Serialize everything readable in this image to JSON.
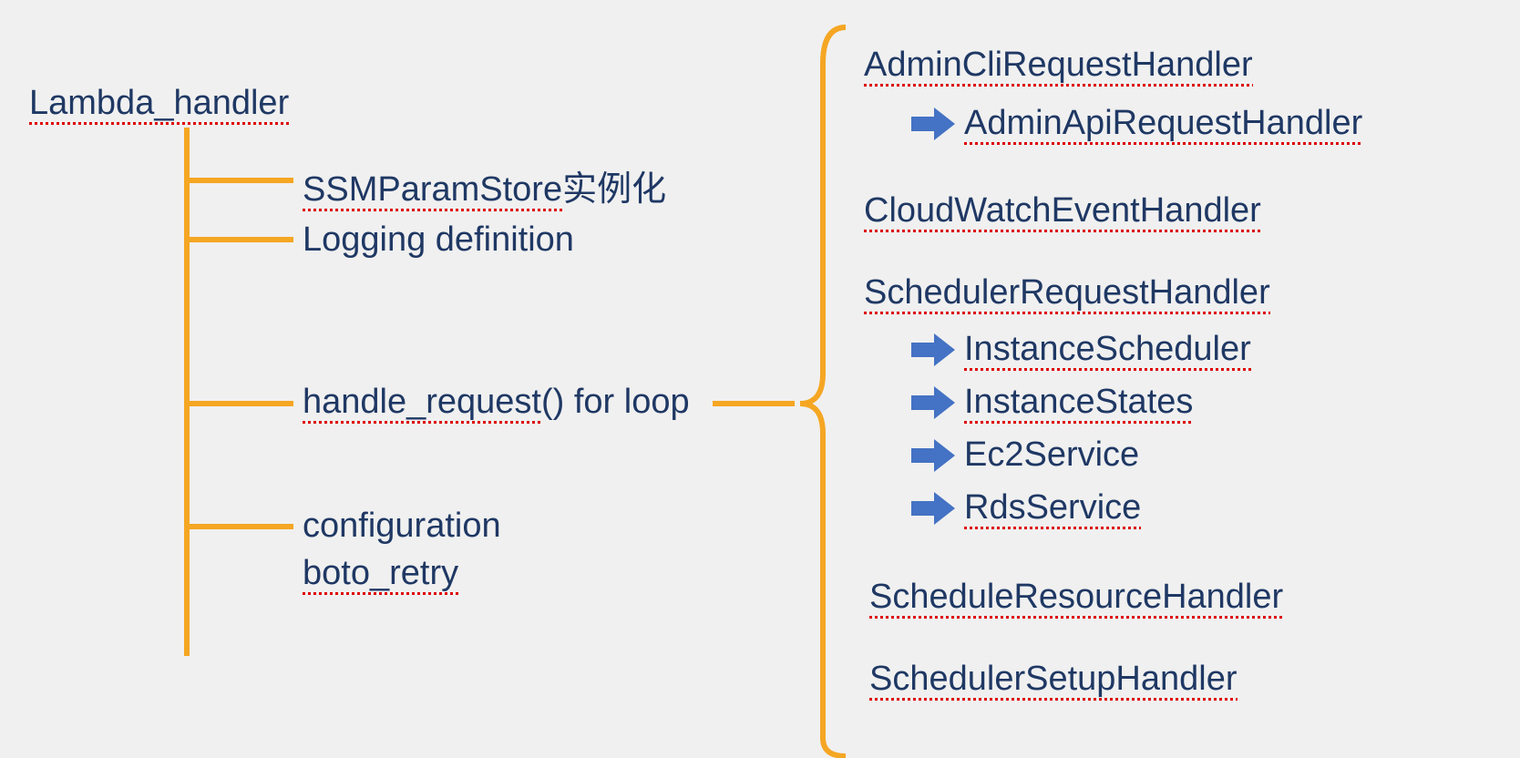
{
  "root": {
    "title": "Lambda_handler",
    "title_spell_part": "Lambda_handler",
    "items": [
      {
        "text_spell": "SSMParamStore",
        "text_plain": "实例化"
      },
      {
        "text_plain_full": "Logging definition"
      },
      {
        "text_spell": "handle_request",
        "text_plain": "() for loop"
      },
      {
        "text_plain_full": "configuration"
      },
      {
        "text_spell": "boto_retry",
        "text_plain": ""
      }
    ]
  },
  "handlers": {
    "items": [
      {
        "name": "AdminCliRequestHandler",
        "children": [
          {
            "name": "AdminApiRequestHandler"
          }
        ]
      },
      {
        "name": "CloudWatchEventHandler"
      },
      {
        "name": "SchedulerRequestHandler",
        "children": [
          {
            "name": "InstanceScheduler"
          },
          {
            "name": "InstanceStates"
          },
          {
            "name": "Ec2Service"
          },
          {
            "name": "RdsService"
          }
        ]
      },
      {
        "name": "ScheduleResourceHandler"
      },
      {
        "name": "SchedulerSetupHandler"
      }
    ]
  },
  "colors": {
    "text": "#1f3864",
    "line_orange": "#f5a623",
    "arrow_blue": "#4472c4"
  }
}
